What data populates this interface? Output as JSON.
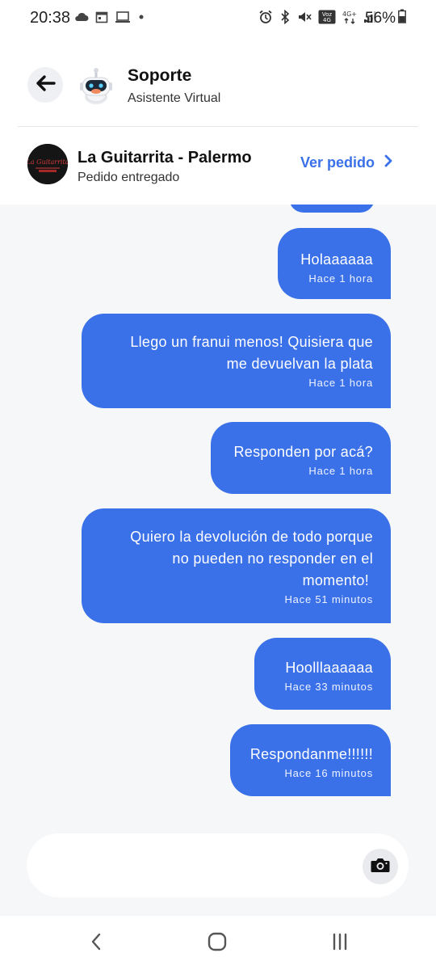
{
  "status_bar": {
    "time": "20:38",
    "battery_percent": "56%",
    "left_icons": [
      "cloud-icon",
      "calendar-icon",
      "laptop-icon",
      "dot-icon"
    ],
    "right_icons": [
      "alarm-icon",
      "bluetooth-icon",
      "mute-icon",
      "volte-icon",
      "4g-icon",
      "signal-icon",
      "battery-icon"
    ],
    "network_label": "4G+",
    "volte_label": "Voz 4G"
  },
  "header": {
    "title": "Soporte",
    "subtitle": "Asistente Virtual",
    "back_icon": "arrow-left-icon",
    "avatar_icon": "robot-avatar-icon"
  },
  "order": {
    "store_name": "La Guitarrita - Palermo",
    "status": "Pedido entregado",
    "action_label": "Ver pedido",
    "logo_text": "La Guitarrita"
  },
  "messages": [
    {
      "lines": [
        "Holaaaaaa"
      ],
      "time": "Hace 1 hora"
    },
    {
      "lines": [
        "Llego un franui menos! Quisiera que",
        "me devuelvan la plata"
      ],
      "time": "Hace 1 hora"
    },
    {
      "lines": [
        "Responden por acá?"
      ],
      "time": "Hace 1 hora"
    },
    {
      "lines": [
        "Quiero la devolución de todo porque",
        "no pueden no responder en el",
        "momento!"
      ],
      "time": "Hace 51 minutos"
    },
    {
      "lines": [
        "Hoolllaaaaaa"
      ],
      "time": "Hace 33 minutos"
    },
    {
      "lines": [
        "Respondanme!!!!!!"
      ],
      "time": "Hace 16 minutos"
    }
  ],
  "input": {
    "placeholder": "",
    "camera_icon": "camera-icon"
  },
  "colors": {
    "accent": "#3a70e8",
    "chat_background": "#f6f7f9"
  }
}
